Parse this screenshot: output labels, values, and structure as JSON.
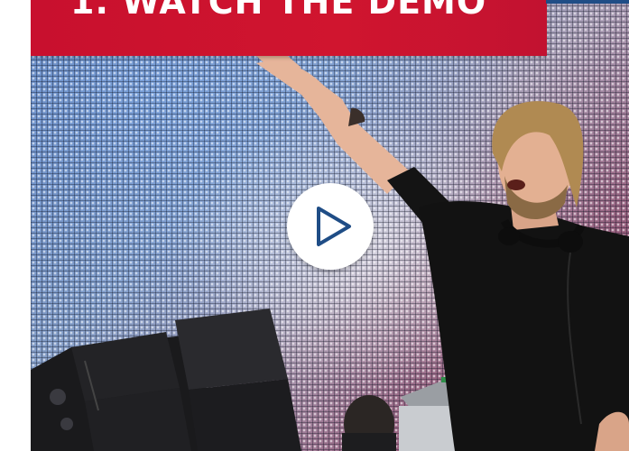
{
  "header": {
    "title": "1. WATCH THE DEMO"
  },
  "video": {
    "play_icon": "play-icon",
    "accent_color": "#c8102e",
    "play_color": "#1f4d86"
  }
}
